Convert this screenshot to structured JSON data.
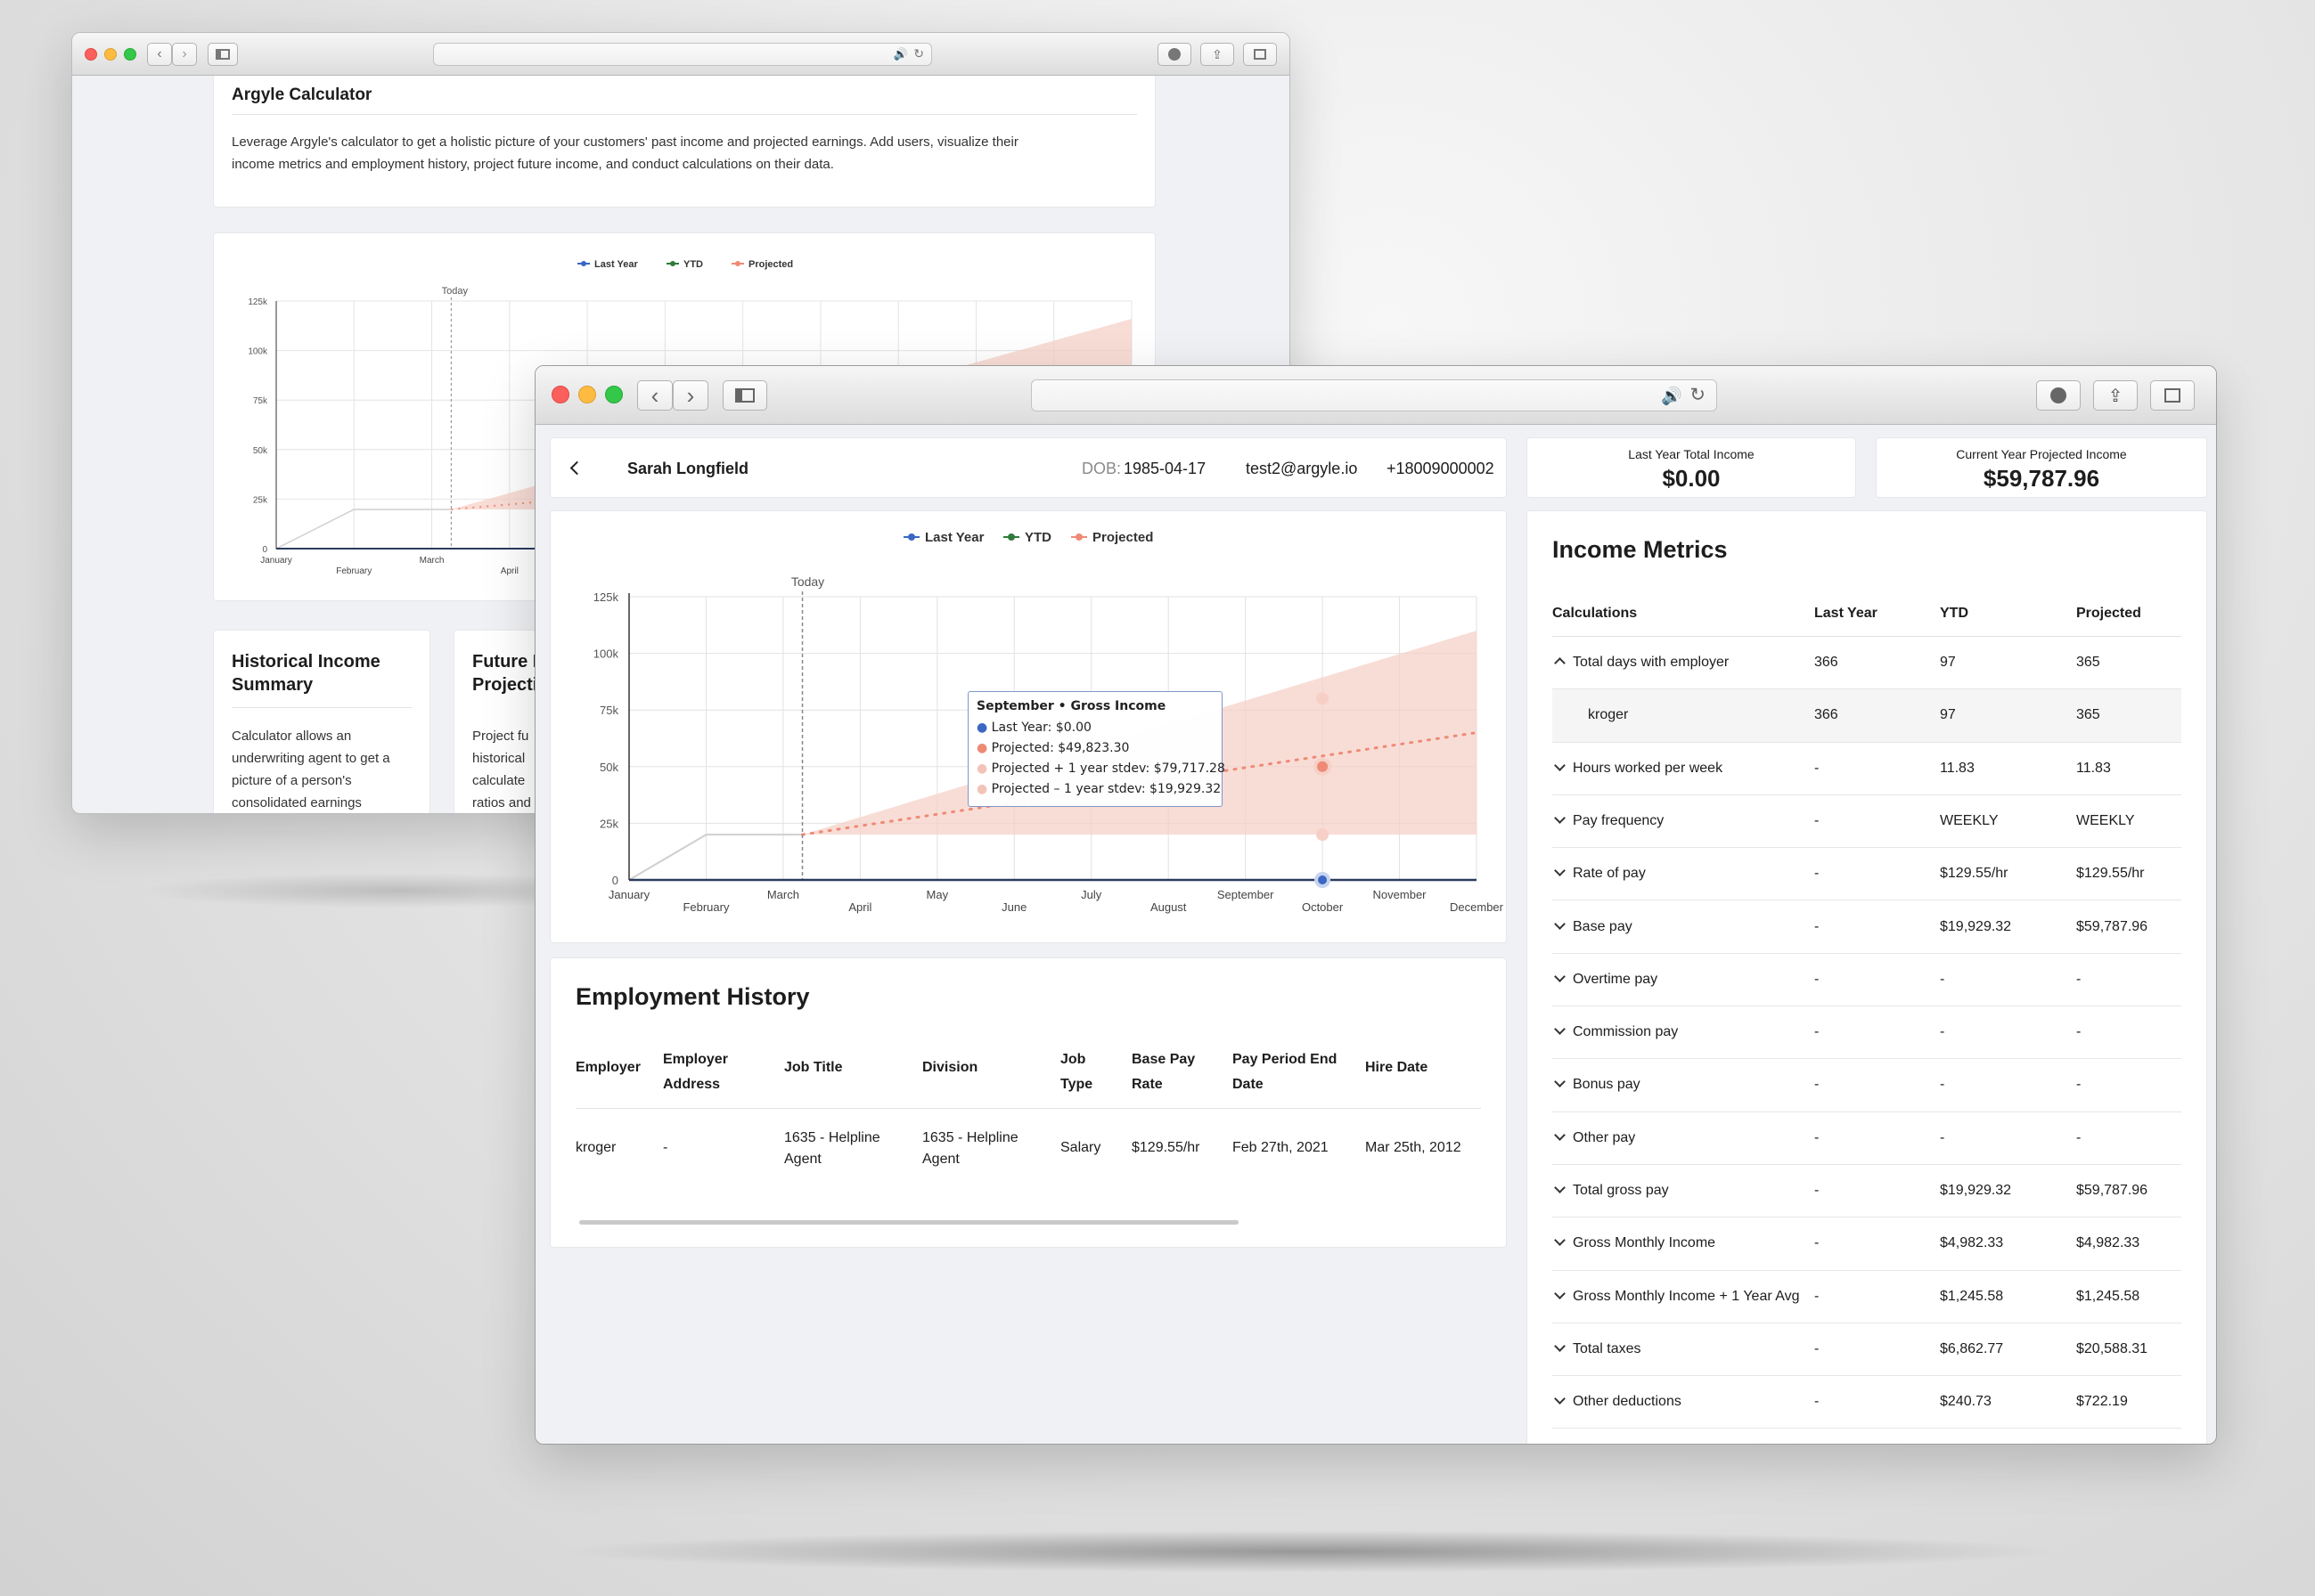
{
  "back_window": {
    "calculator_title": "Argyle Calculator",
    "calculator_desc_line1": "Leverage Argyle's calculator to get a holistic picture of your customers' past income and projected earnings. Add users, visualize their",
    "calculator_desc_line2": "income metrics and employment history, project future income, and conduct calculations on their data.",
    "legend": [
      "Last Year",
      "YTD",
      "Projected"
    ],
    "today_label": "Today",
    "y_ticks": [
      "125k",
      "100k",
      "75k",
      "50k",
      "25k",
      "0"
    ],
    "x_ticks": [
      "January",
      "February",
      "March",
      "April"
    ],
    "card1_title_l1": "Historical Income",
    "card1_title_l2": "Summary",
    "card1_text": [
      "Calculator allows an",
      "underwriting agent to get a",
      "picture of a person's",
      "consolidated earnings"
    ],
    "card2_title_l1": "Future I",
    "card2_title_l2": "Projecti",
    "card2_text": [
      "Project fu",
      "historical",
      "calculate",
      "ratios and"
    ]
  },
  "profile": {
    "name": "Sarah Longfield",
    "dob_label": "DOB:",
    "dob": "1985-04-17",
    "email": "test2@argyle.io",
    "phone": "+18009000002"
  },
  "summary": {
    "last_year_label": "Last Year Total Income",
    "last_year_value": "$0.00",
    "projected_label": "Current Year Projected Income",
    "projected_value": "$59,787.96"
  },
  "chart_data": {
    "type": "line",
    "legend": [
      "Last Year",
      "YTD",
      "Projected"
    ],
    "today_label": "Today",
    "y_ticks": [
      "125k",
      "100k",
      "75k",
      "50k",
      "25k",
      "0"
    ],
    "ylim": [
      0,
      125000
    ],
    "categories": [
      "January",
      "February",
      "March",
      "April",
      "May",
      "June",
      "July",
      "August",
      "September",
      "October",
      "November",
      "December"
    ],
    "today_index": 3.25,
    "series": [
      {
        "name": "Last Year",
        "color": "#3a67c4",
        "values": [
          0,
          0,
          0,
          0,
          0,
          0,
          0,
          0,
          0,
          0,
          0,
          0
        ]
      },
      {
        "name": "YTD",
        "color": "#cfcfcf",
        "x": [
          1,
          2,
          3.25
        ],
        "values": [
          0,
          20000,
          20000
        ]
      },
      {
        "name": "Projected",
        "color": "#ee8a76",
        "x": [
          3.25,
          12
        ],
        "values": [
          20000,
          65000
        ]
      }
    ],
    "band": {
      "x": [
        3.25,
        12
      ],
      "upper": [
        20000,
        110000
      ],
      "lower": [
        20000,
        20000
      ]
    },
    "tooltip": {
      "title": "September • Gross Income",
      "lines": [
        "Last Year: $0.00",
        "Projected: $49,823.30",
        "Projected + 1 year stdev: $79,717.28",
        "Projected – 1 year stdev: $19,929.32"
      ]
    }
  },
  "employment": {
    "title": "Employment History",
    "headers": [
      "Employer",
      "Employer Address",
      "Job Title",
      "Division",
      "Job Type",
      "Base Pay Rate",
      "Pay Period End Date",
      "Hire Date"
    ],
    "row": [
      "kroger",
      "-",
      "1635 - Helpline Agent",
      "1635 - Helpline Agent",
      "Salary",
      "$129.55/hr",
      "Feb 27th, 2021",
      "Mar 25th, 2012"
    ]
  },
  "metrics": {
    "title": "Income Metrics",
    "headers": [
      "Calculations",
      "Last Year",
      "YTD",
      "Projected"
    ],
    "rows": [
      {
        "label": "Total days with employer",
        "ly": "366",
        "ytd": "97",
        "proj": "365",
        "expanded": true
      },
      {
        "label": "kroger",
        "ly": "366",
        "ytd": "97",
        "proj": "365",
        "sub": true
      },
      {
        "label": "Hours worked per week",
        "ly": "-",
        "ytd": "11.83",
        "proj": "11.83"
      },
      {
        "label": "Pay frequency",
        "ly": "-",
        "ytd": "WEEKLY",
        "proj": "WEEKLY"
      },
      {
        "label": "Rate of pay",
        "ly": "-",
        "ytd": "$129.55/hr",
        "proj": "$129.55/hr"
      },
      {
        "label": "Base pay",
        "ly": "-",
        "ytd": "$19,929.32",
        "proj": "$59,787.96"
      },
      {
        "label": "Overtime pay",
        "ly": "-",
        "ytd": "-",
        "proj": "-"
      },
      {
        "label": "Commission pay",
        "ly": "-",
        "ytd": "-",
        "proj": "-"
      },
      {
        "label": "Bonus pay",
        "ly": "-",
        "ytd": "-",
        "proj": "-"
      },
      {
        "label": "Other pay",
        "ly": "-",
        "ytd": "-",
        "proj": "-"
      },
      {
        "label": "Total gross pay",
        "ly": "-",
        "ytd": "$19,929.32",
        "proj": "$59,787.96"
      },
      {
        "label": "Gross Monthly Income",
        "ly": "-",
        "ytd": "$4,982.33",
        "proj": "$4,982.33"
      },
      {
        "label": "Gross Monthly Income + 1 Year Avg",
        "ly": "-",
        "ytd": "$1,245.58",
        "proj": "$1,245.58"
      },
      {
        "label": "Total taxes",
        "ly": "-",
        "ytd": "$6,862.77",
        "proj": "$20,588.31"
      },
      {
        "label": "Other deductions",
        "ly": "-",
        "ytd": "$240.73",
        "proj": "$722.19"
      }
    ]
  }
}
